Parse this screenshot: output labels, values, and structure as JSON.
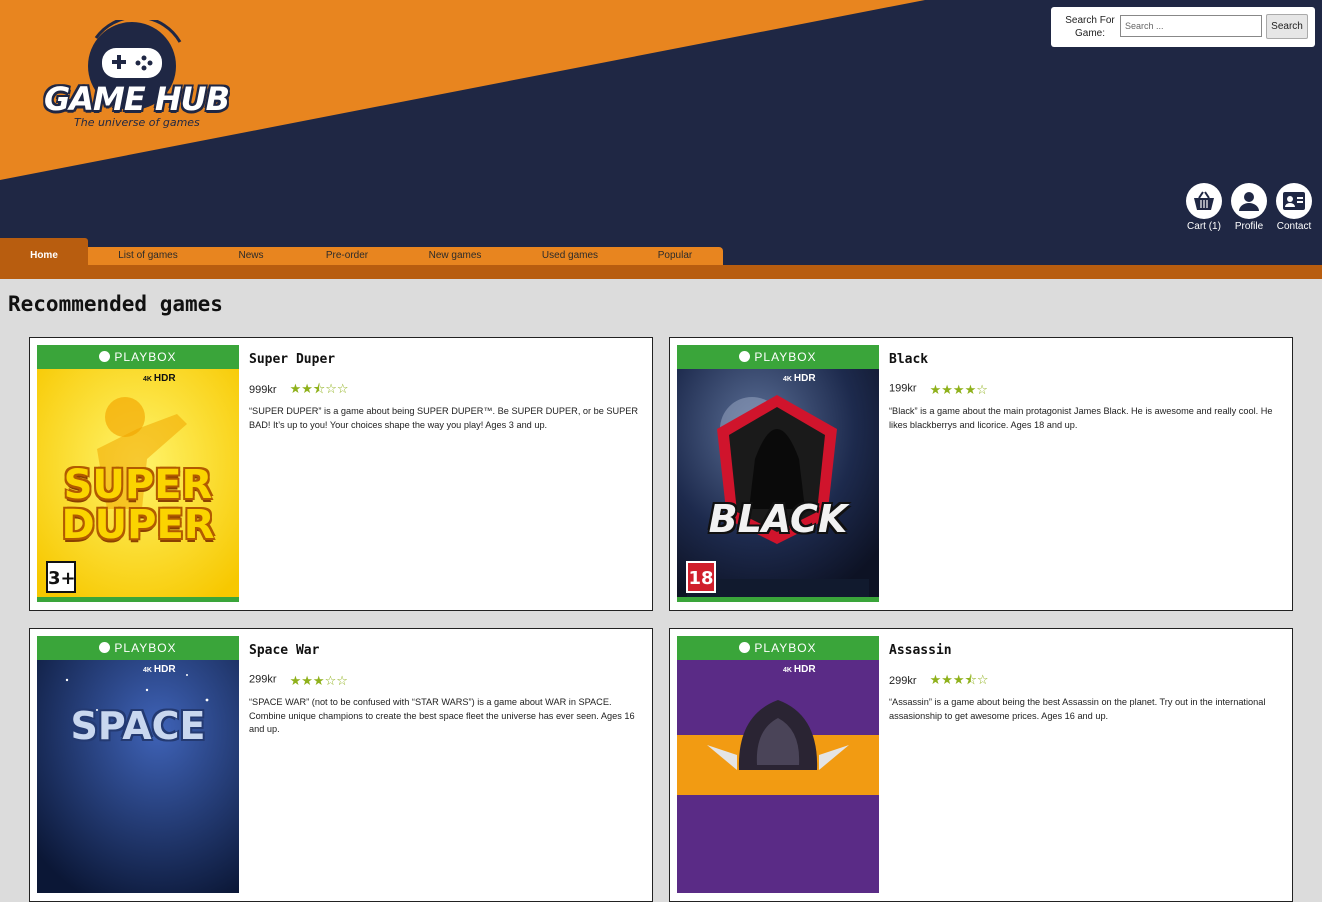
{
  "brand": {
    "name": "GAME HUB",
    "tagline": "The universe of games"
  },
  "search": {
    "label": "Search For Game:",
    "placeholder": "Search ...",
    "button": "Search"
  },
  "header_actions": [
    {
      "label": "Cart (1)",
      "icon": "basket-icon"
    },
    {
      "label": "Profile",
      "icon": "person-icon"
    },
    {
      "label": "Contact",
      "icon": "contact-card-icon"
    }
  ],
  "nav": [
    {
      "label": "Home",
      "active": true
    },
    {
      "label": "List of games"
    },
    {
      "label": "News"
    },
    {
      "label": "Pre-order"
    },
    {
      "label": "New games"
    },
    {
      "label": "Used games"
    },
    {
      "label": "Popular"
    }
  ],
  "section_title": "Recommended games",
  "cover_brand": "PLAYBOX",
  "cover_badges": {
    "resolution": "4K",
    "hdr": "HDR"
  },
  "games": [
    {
      "title": "Super Duper",
      "price": "999kr",
      "rating": 2.5,
      "stars": "★★⯪☆☆",
      "description": "“SUPER DUPER” is a game about being SUPER DUPER™. Be SUPER DUPER, or be SUPER BAD! It’s up to you! Your choices shape the way you play! Ages 3 and up.",
      "cover_text": [
        "SUPER",
        "DUPER"
      ],
      "age_rating": "3+"
    },
    {
      "title": "Black",
      "price": "199kr",
      "rating": 4,
      "stars": "★★★★☆",
      "description": "“Black” is a game about the main protagonist James Black. He is awesome and really cool. He likes blackberrys and licorice. Ages 18 and up.",
      "cover_text": [
        "BLACK"
      ],
      "age_rating": "18"
    },
    {
      "title": "Space War",
      "price": "299kr",
      "rating": 3,
      "stars": "★★★☆☆",
      "description": "“SPACE WAR” (not to be confused with “STAR WARS”) is a game about WAR in SPACE. Combine unique champions to create the best space fleet the universe has ever seen. Ages 16 and up.",
      "cover_text": [
        "SPACE"
      ]
    },
    {
      "title": "Assassin",
      "price": "299kr",
      "rating": 3.5,
      "stars": "★★★⯪☆",
      "description": "“Assassin” is a game about being the best Assassin on the planet. Try out in the international assasionship to get awesome prices. Ages 16 and up."
    }
  ],
  "colors": {
    "navy": "#1f2744",
    "orange": "#e8851f",
    "dark_orange": "#b85d0f",
    "playbox_green": "#3aa53a",
    "star_green": "#8fb11b"
  }
}
